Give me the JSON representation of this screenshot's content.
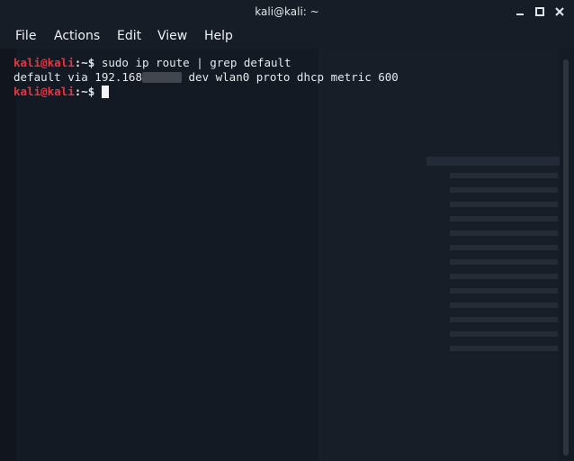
{
  "window": {
    "title": "kali@kali: ~"
  },
  "menu": {
    "items": [
      "File",
      "Actions",
      "Edit",
      "View",
      "Help"
    ]
  },
  "terminal": {
    "prompt_user": "kali@kali",
    "prompt_sep": ":~$",
    "line1_command": " sudo ip route | grep default",
    "line2_prefix": "default via 192.168",
    "line2_suffix": " dev wlan0 proto dhcp metric 600",
    "line3_command": " "
  },
  "colors": {
    "prompt_user": "#e8343f",
    "background": "#141a23",
    "text": "#e6e9ec"
  },
  "icons": {
    "minimize": "minimize-icon",
    "maximize": "maximize-icon",
    "close": "close-icon"
  }
}
